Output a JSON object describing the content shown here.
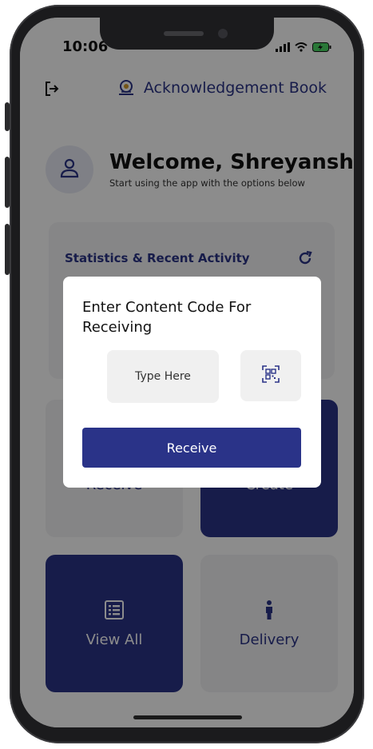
{
  "status_bar": {
    "time": "10:06",
    "icons": [
      "signal-icon",
      "wifi-icon",
      "battery-charging-icon"
    ]
  },
  "app_bar": {
    "title": "Acknowledgement Book",
    "logout_icon": "logout-icon",
    "logo_icon": "emblem-icon"
  },
  "welcome": {
    "greeting": "Welcome, Shreyansh",
    "subtitle": "Start using the app with the options below",
    "avatar_icon": "user-icon"
  },
  "stats_card": {
    "title": "Statistics & Recent Activity",
    "refresh_icon": "refresh-icon"
  },
  "tiles": [
    {
      "label": "Receive",
      "icon": "receive-icon"
    },
    {
      "label": "Create",
      "icon": "create-icon"
    },
    {
      "label": "View All",
      "icon": "list-icon"
    },
    {
      "label": "Delivery",
      "icon": "person-icon"
    }
  ],
  "dialog": {
    "title": "Enter Content Code For Receiving",
    "input_placeholder": "Type Here",
    "input_value": "",
    "qr_icon": "qr-scan-icon",
    "submit_label": "Receive"
  },
  "colors": {
    "brand": "#2a3388",
    "tile_light": "#f2f2f4",
    "overlay": "rgba(0,0,0,0.45)"
  }
}
